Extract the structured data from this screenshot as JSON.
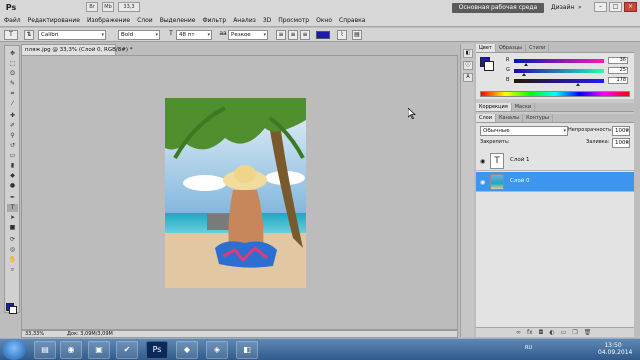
{
  "app": {
    "logo": "Ps",
    "workspace_button": "Основная рабочая среда",
    "design_link": "Дизайн",
    "more": "»",
    "window_controls": [
      "–",
      "□",
      "×"
    ]
  },
  "menu": [
    "Файл",
    "Редактирование",
    "Изображение",
    "Слои",
    "Выделение",
    "Фильтр",
    "Анализ",
    "3D",
    "Просмотр",
    "Окно",
    "Справка"
  ],
  "top_icons": [
    "Br",
    "Mb",
    "33,3"
  ],
  "options": {
    "font_family": "Calibri",
    "font_style": "Bold",
    "font_size": "48 пт",
    "antialias": "Резкое",
    "text_color": "#1b1bb4"
  },
  "document": {
    "tab_title": "пляж.jpg @ 33,3% (Слой 0, RGB/8#) *",
    "zoom": "33,33%",
    "doc_size": "Док: 3,09M/3,09M"
  },
  "tools_panel": {
    "foreground_color": "#1b1bb4",
    "background_color": "#ffffff"
  },
  "color_panel": {
    "tabs": [
      "Цвет",
      "Образцы",
      "Стили"
    ],
    "channels": [
      {
        "label": "R",
        "value": "36"
      },
      {
        "label": "G",
        "value": "25"
      },
      {
        "label": "B",
        "value": "178"
      }
    ],
    "swatch": "#1b1bb4"
  },
  "adjust_panel": {
    "tabs": [
      "Коррекция",
      "Маски"
    ]
  },
  "layers_panel": {
    "tabs": [
      "Слои",
      "Каналы",
      "Контуры"
    ],
    "blend_mode": "Обычные",
    "opacity_label": "Непрозрачность:",
    "opacity_value": "100%",
    "lock_label": "Закрепить:",
    "fill_label": "Заливка:",
    "fill_value": "100%",
    "layers": [
      {
        "name": "Слой 1",
        "thumb": "T",
        "selected": false
      },
      {
        "name": "Слой 0",
        "thumb": "",
        "selected": true
      }
    ]
  },
  "taskbar": {
    "lang": "RU",
    "time": "13:50",
    "date": "04.09.2014"
  }
}
